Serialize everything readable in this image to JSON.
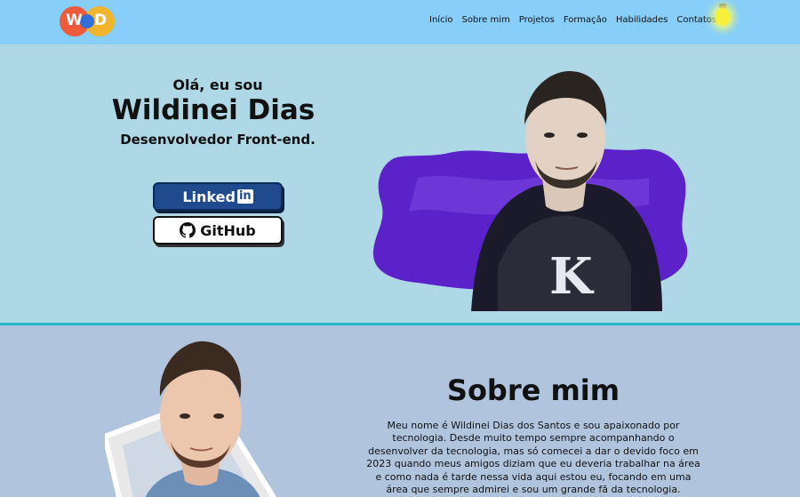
{
  "header": {
    "logo_letters": [
      "W",
      "D"
    ],
    "nav": [
      "Início",
      "Sobre mim",
      "Projetos",
      "Formação",
      "Habilidades",
      "Contatos"
    ],
    "theme_icon": "lightbulb-icon"
  },
  "hero": {
    "greeting": "Olá, eu sou",
    "name": "Wildinei Dias",
    "role": "Desenvolvedor Front-end.",
    "linkedin_label": "Linked",
    "linkedin_badge": "in",
    "github_label": "GitHub"
  },
  "about": {
    "title": "Sobre mim",
    "text": "Meu nome é Wildinei Dias dos Santos e sou apaixonado por tecnologia. Desde muito tempo sempre acompanhando o desenvolver da tecnologia, mas só comecei a dar o devido foco em 2023 quando meus amigos diziam que eu deveria trabalhar na área e como nada é tarde nessa vida aqui estou eu, focando em uma área que sempre admirei e sou um grande fã da tecnologia."
  },
  "colors": {
    "header_bg": "#87cefa",
    "hero_bg": "#aed8e6",
    "about_bg": "#b0c4de",
    "divider": "#22b8c8",
    "linkedin": "#1f4b8e",
    "splash": "#5a22c8"
  }
}
